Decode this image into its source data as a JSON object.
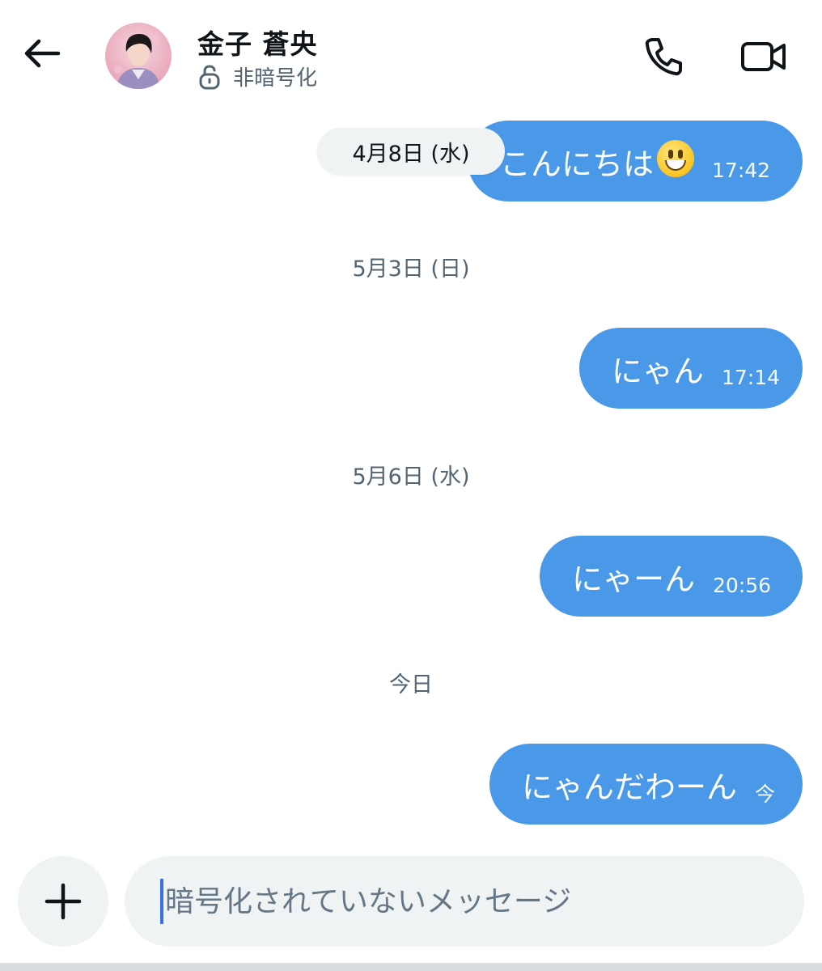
{
  "header": {
    "contact_name": "金子 蒼央",
    "encryption_status": "非暗号化",
    "icons": {
      "back": "arrow-left-icon",
      "lock": "unlocked-icon",
      "call": "phone-icon",
      "video": "video-camera-icon"
    }
  },
  "messages": [
    {
      "date": "4月8日 (水)",
      "text": "こんにちは",
      "emoji": "smiley-emoji",
      "time": "17:42"
    },
    {
      "date": "5月3日 (日)",
      "text": "にゃん",
      "time": "17:14"
    },
    {
      "date": "5月6日 (水)",
      "text": "にゃーん",
      "time": "20:56"
    },
    {
      "date": "今日",
      "text": "にゃんだわーん",
      "time": "今"
    }
  ],
  "composer": {
    "placeholder": "暗号化されていないメッセージ",
    "add_icon": "plus-icon"
  },
  "colors": {
    "bubble": "#4a99e9",
    "pill_bg": "#eff3f4",
    "secondary_text": "#536471"
  }
}
